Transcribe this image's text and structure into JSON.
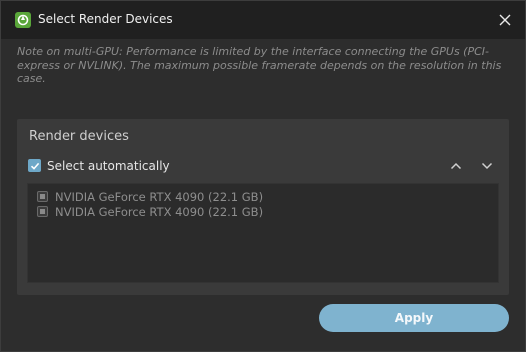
{
  "window": {
    "title": "Select Render Devices",
    "icon": "render-app-icon",
    "close_icon": "close-icon"
  },
  "note": "Note on multi-GPU: Performance is limited by the interface connecting the GPUs (PCI-express or NVLINK). The maximum possible framerate depends on the resolution in this case.",
  "render_devices": {
    "title": "Render devices",
    "auto_select_label": "Select automatically",
    "auto_select_checked": true,
    "move_up_icon": "chevron-up-icon",
    "move_down_icon": "chevron-down-icon",
    "devices": [
      {
        "label": "NVIDIA GeForce RTX 4090 (22.1 GB)",
        "checked": true
      },
      {
        "label": "NVIDIA GeForce RTX 4090 (22.1 GB)",
        "checked": true
      }
    ]
  },
  "actions": {
    "apply_label": "Apply"
  },
  "colors": {
    "accent": "#7fb3cf",
    "checkbox": "#6ea8c8",
    "app_icon": "#5aa63a"
  }
}
